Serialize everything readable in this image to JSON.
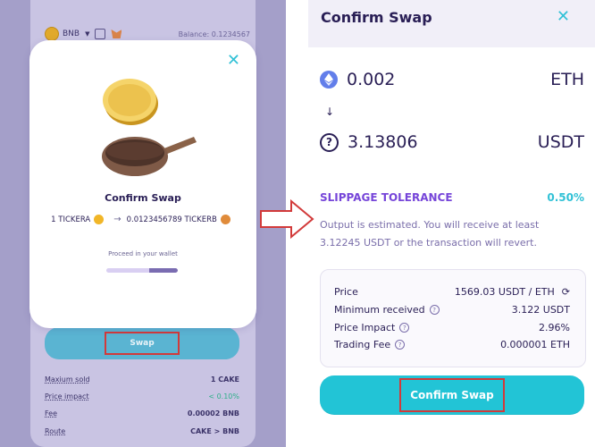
{
  "left": {
    "top": {
      "network": "BNB",
      "balance": "Balance: 0.1234567"
    },
    "modal": {
      "title": "Confirm Swap",
      "from_amount": "1 TICKERA",
      "to_amount": "0.0123456789 TICKERB",
      "proceed": "Proceed in your wallet",
      "progress": 0.6
    },
    "swap_label": "Swap",
    "details": [
      {
        "label": "Maxium sold",
        "value": "1 CAKE"
      },
      {
        "label": "Price impact",
        "value": "< 0.10%"
      },
      {
        "label": "Fee",
        "value": "0.00002 BNB"
      },
      {
        "label": "Route",
        "value": "CAKE > BNB"
      }
    ]
  },
  "right": {
    "title": "Confirm Swap",
    "input": {
      "amount": "0.002",
      "symbol": "ETH"
    },
    "output": {
      "amount": "3.13806",
      "symbol": "USDT"
    },
    "slippage": {
      "label": "SLIPPAGE TOLERANCE",
      "value": "0.50%"
    },
    "estimate_line1": "Output is estimated. You will receive at least",
    "estimate_line2": "3.12245 USDT or the transaction will revert.",
    "summary": [
      {
        "label": "Price",
        "value": "1569.03 USDT / ETH"
      },
      {
        "label": "Minimum received",
        "value": "3.122 USDT"
      },
      {
        "label": "Price Impact",
        "value": "2.96%"
      },
      {
        "label": "Trading Fee",
        "value": "0.000001 ETH"
      }
    ],
    "confirm_label": "Confirm Swap"
  },
  "colors": {
    "accent": "#31c1d6",
    "primary_text": "#291e55",
    "slippage": "#7645d9",
    "highlight_border": "#d23a3a"
  }
}
